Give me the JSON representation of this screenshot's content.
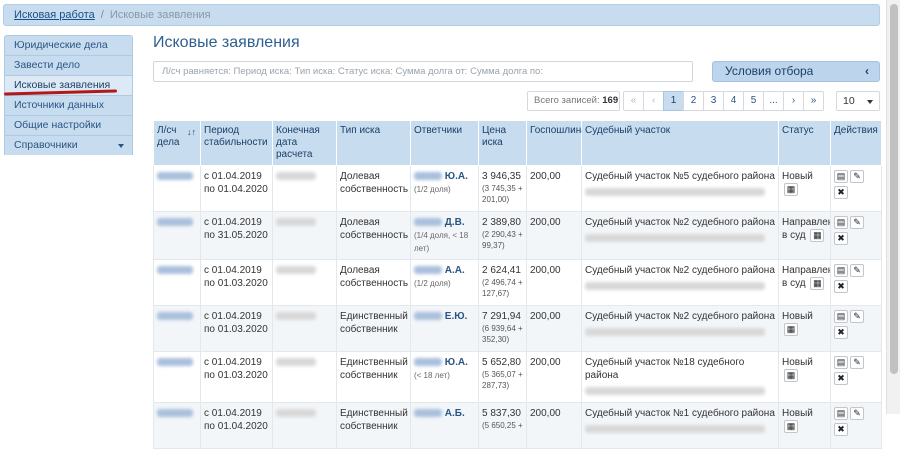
{
  "breadcrumb": {
    "root": "Исковая работа",
    "current": "Исковые заявления"
  },
  "sidebar": {
    "items": [
      {
        "label": "Юридические дела"
      },
      {
        "label": "Завести дело"
      },
      {
        "label": "Исковые заявления"
      },
      {
        "label": "Источники данных"
      },
      {
        "label": "Общие настройки"
      },
      {
        "label": "Справочники"
      }
    ],
    "active_index": 2
  },
  "page": {
    "title": "Исковые заявления"
  },
  "filter": {
    "placeholder": "Л/сч равняется: Период иска: Тип иска: Статус иска: Сумма долга от: Сумма долга по:",
    "conditions_label": "Условия отбора"
  },
  "pager": {
    "total_label": "Всего записей:",
    "total": "169",
    "pages": [
      "«",
      "‹",
      "1",
      "2",
      "3",
      "4",
      "5",
      "...",
      "›",
      "»"
    ],
    "current": "1",
    "per_page": "10"
  },
  "table": {
    "headers": [
      "Л/сч дела",
      "Период стабильности",
      "Конечная дата расчета",
      "Тип иска",
      "Ответчики",
      "Цена иска",
      "Госпошлина",
      "Судебный участок",
      "Статус",
      "Действия"
    ],
    "rows": [
      {
        "period_from": "с 01.04.2019",
        "period_to": "по 01.04.2020",
        "type": "Долевая собственность",
        "resp_name": "Ю.А.",
        "resp_note": "(1/2 доля)",
        "price": "3 946,35",
        "price_sub": "(3 745,35 + 201,00)",
        "fee": "200,00",
        "court": "Судебный участок №5 судебного района",
        "status": "Новый"
      },
      {
        "period_from": "с 01.04.2019",
        "period_to": "по 31.05.2020",
        "type": "Долевая собственность",
        "resp_name": "Д.В.",
        "resp_note": "(1/4 доля, < 18 лет)",
        "price": "2 389,80",
        "price_sub": "(2 290,43 + 99,37)",
        "fee": "200,00",
        "court": "Судебный участок №2 судебного района",
        "status": "Направлен в суд"
      },
      {
        "period_from": "с 01.04.2019",
        "period_to": "по 01.03.2020",
        "type": "Долевая собственность",
        "resp_name": "А.А.",
        "resp_note": "(1/2 доля)",
        "price": "2 624,41",
        "price_sub": "(2 496,74 + 127,67)",
        "fee": "200,00",
        "court": "Судебный участок №2 судебного района",
        "status": "Направлен в суд"
      },
      {
        "period_from": "с 01.04.2019",
        "period_to": "по 01.03.2020",
        "type": "Единственный собственник",
        "resp_name": "Е.Ю.",
        "resp_note": "",
        "price": "7 291,94",
        "price_sub": "(6 939,64 + 352,30)",
        "fee": "200,00",
        "court": "Судебный участок №2 судебного района",
        "status": "Новый"
      },
      {
        "period_from": "с 01.04.2019",
        "period_to": "по 01.03.2020",
        "type": "Единственный собственник",
        "resp_name": "Ю.А.",
        "resp_note": "(< 18 лет)",
        "price": "5 652,80",
        "price_sub": "(5 365,07 + 287,73)",
        "fee": "200,00",
        "court": "Судебный участок №18 судебного района",
        "status": "Новый"
      },
      {
        "period_from": "с 01.04.2019",
        "period_to": "по 01.04.2020",
        "type": "Единственный собственник",
        "resp_name": "А.Б.",
        "resp_note": "",
        "price": "5 837,30",
        "price_sub": "(5 650,25 +",
        "fee": "200,00",
        "court": "Судебный участок №1 судебного района",
        "status": "Новый"
      }
    ]
  },
  "icons": {
    "calendar": "calendar-icon",
    "view": "list-icon",
    "edit": "pencil-icon",
    "delete": "close-icon",
    "sort": "sort-icon"
  },
  "colors": {
    "accent": "#c7dcef",
    "title": "#2f5f92",
    "underline": "#b01a1a"
  }
}
